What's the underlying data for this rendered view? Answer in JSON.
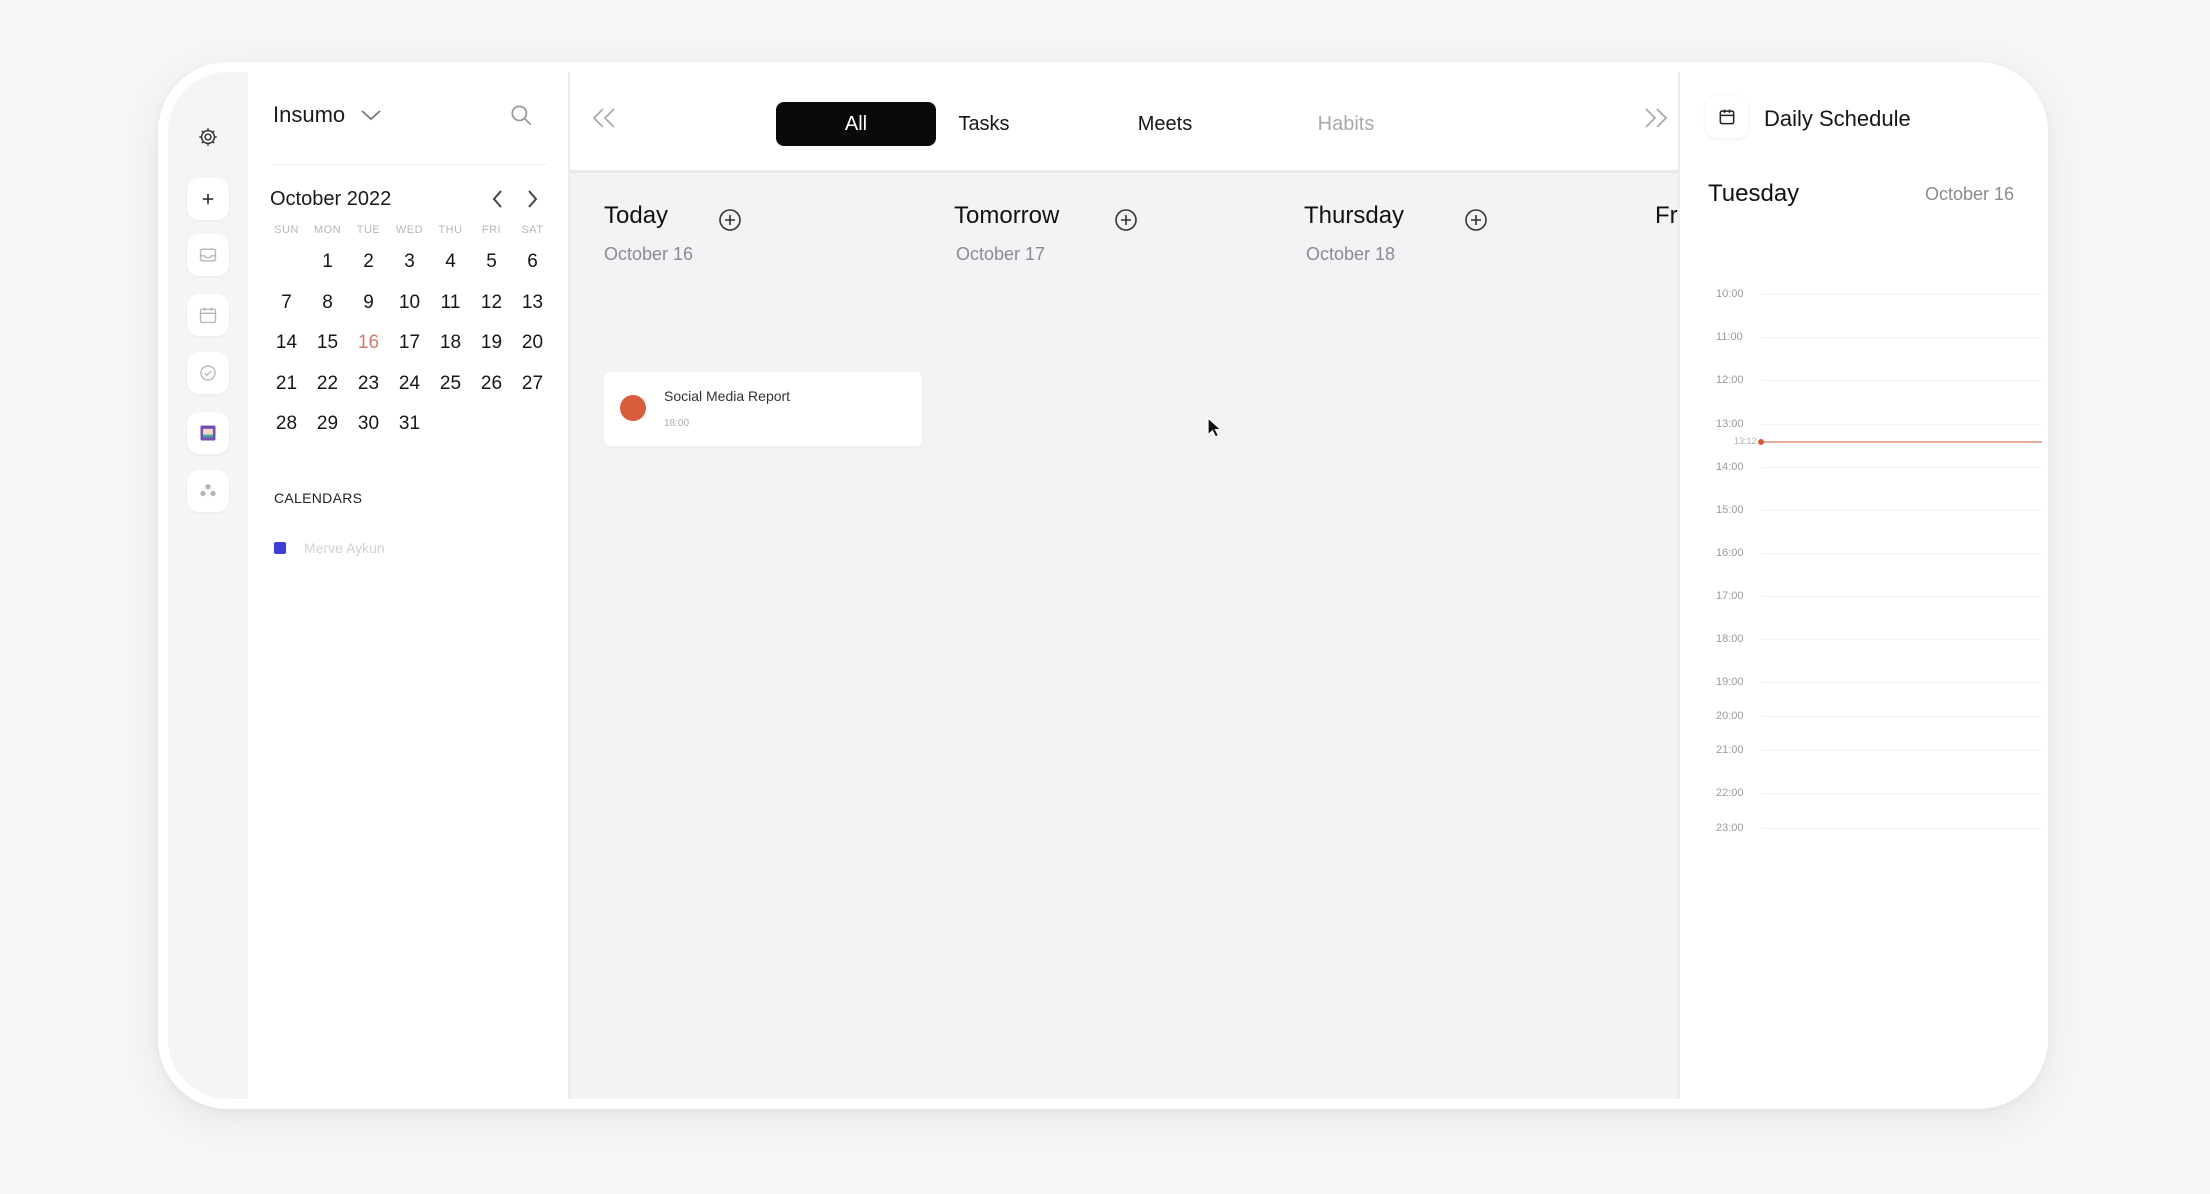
{
  "sidebar_icons": [
    "gear-icon",
    "plus-icon",
    "inbox-icon",
    "calendar-icon",
    "check-circle-icon",
    "calendar-grid-icon",
    "team-icon"
  ],
  "workspace": {
    "name": "Insumo"
  },
  "mini_calendar": {
    "month_label": "October 2022",
    "weekdays": [
      "SUN",
      "MON",
      "TUE",
      "WED",
      "THU",
      "FRI",
      "SAT"
    ],
    "weeks": [
      [
        "",
        "1",
        "2",
        "3",
        "4",
        "5",
        "6"
      ],
      [
        "7",
        "8",
        "9",
        "10",
        "11",
        "12",
        "13"
      ],
      [
        "14",
        "15",
        "16",
        "17",
        "18",
        "19",
        "20"
      ],
      [
        "21",
        "22",
        "23",
        "24",
        "25",
        "26",
        "27"
      ],
      [
        "28",
        "29",
        "30",
        "31",
        "",
        "",
        ""
      ]
    ],
    "today": "16",
    "today_color": "#c8806a"
  },
  "calendars": {
    "heading": "CALENDARS",
    "items": [
      {
        "name": "Merve Aykun",
        "color": "#3f3fd6"
      }
    ]
  },
  "filter_tabs": {
    "items": [
      {
        "label": "All",
        "active": true
      },
      {
        "label": "Tasks",
        "active": false
      },
      {
        "label": "Meets",
        "active": false
      },
      {
        "label": "Habits",
        "active": false
      }
    ]
  },
  "columns": [
    {
      "title": "Today",
      "date": "October 16"
    },
    {
      "title": "Tomorrow",
      "date": "October 17"
    },
    {
      "title": "Thursday",
      "date": "October 18"
    },
    {
      "title": "Fri",
      "date": ""
    }
  ],
  "tasks": [
    {
      "title": "Social Media Report",
      "time": "18:00",
      "color": "#d95c3c"
    }
  ],
  "daily_schedule": {
    "title": "Daily Schedule",
    "day": "Tuesday",
    "date": "October 16",
    "hours": [
      "10:00",
      "11:00",
      "12:00",
      "13:00",
      "14:00",
      "15:00",
      "16:00",
      "17:00",
      "18:00",
      "19:00",
      "20:00",
      "21:00",
      "22:00",
      "23:00"
    ],
    "now_time": "13:12",
    "accent": "#d95c3c"
  }
}
